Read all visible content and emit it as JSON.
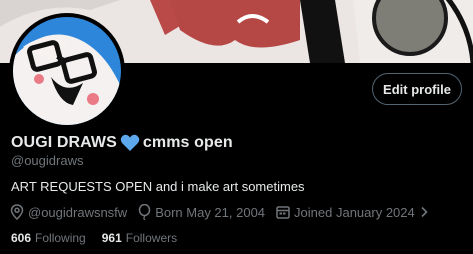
{
  "profile": {
    "name": "OUGI DRAWS",
    "name_suffix": "cmms open",
    "handle": "@ougidraws",
    "bio": "ART REQUESTS OPEN and i  make art sometimes",
    "heart_color": "#5da8ec"
  },
  "actions": {
    "edit_profile_label": "Edit profile"
  },
  "meta": {
    "location": "@ougidrawsnsfw",
    "birthday": "Born May 21, 2004",
    "joined": "Joined January 2024"
  },
  "stats": {
    "following_count": "606",
    "following_label": "Following",
    "followers_count": "961",
    "followers_label": "Followers"
  },
  "icons": {
    "location": "map-pin-icon",
    "birthday": "balloon-icon",
    "joined": "calendar-icon",
    "joined_more": "chevron-right-icon"
  }
}
